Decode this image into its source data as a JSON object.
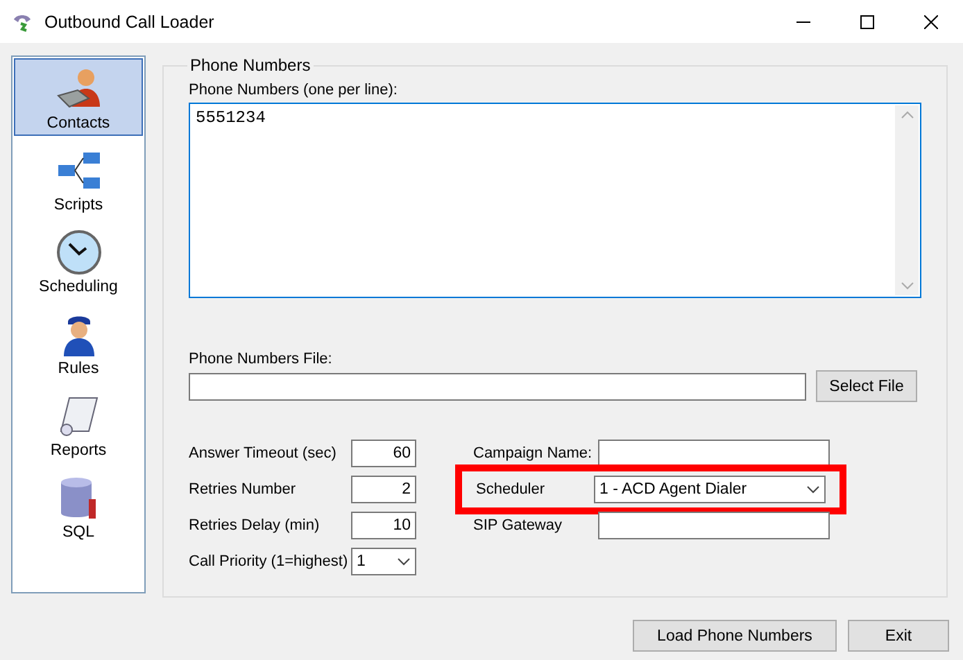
{
  "window": {
    "title": "Outbound Call Loader"
  },
  "sidebar": {
    "items": [
      {
        "label": "Contacts",
        "kind": "contacts",
        "selected": true
      },
      {
        "label": "Scripts",
        "kind": "scripts",
        "selected": false
      },
      {
        "label": "Scheduling",
        "kind": "scheduling",
        "selected": false
      },
      {
        "label": "Rules",
        "kind": "rules",
        "selected": false
      },
      {
        "label": "Reports",
        "kind": "reports",
        "selected": false
      },
      {
        "label": "SQL",
        "kind": "sql",
        "selected": false
      }
    ]
  },
  "group": {
    "title": "Phone Numbers"
  },
  "phone_numbers": {
    "label": "Phone Numbers (one per line):",
    "value": "5551234"
  },
  "phone_file": {
    "label": "Phone Numbers File:",
    "button": "Select File"
  },
  "settings_left": [
    {
      "label": "Answer Timeout (sec)",
      "value": "60",
      "kind": "number"
    },
    {
      "label": "Retries Number",
      "value": "2",
      "kind": "number"
    },
    {
      "label": "Retries Delay (min)",
      "value": "10",
      "kind": "number"
    },
    {
      "label": "Call Priority (1=highest)",
      "value": "1",
      "kind": "dropdown"
    }
  ],
  "settings_right": [
    {
      "label": "Campaign Name:",
      "kind": "text",
      "highlighted": false
    },
    {
      "label": "Scheduler",
      "value": "1 - ACD Agent Dialer",
      "kind": "dropdown",
      "highlighted": true
    },
    {
      "label": "SIP Gateway",
      "kind": "text",
      "highlighted": false
    }
  ],
  "buttons": [
    "Load Phone Numbers",
    "Exit"
  ]
}
